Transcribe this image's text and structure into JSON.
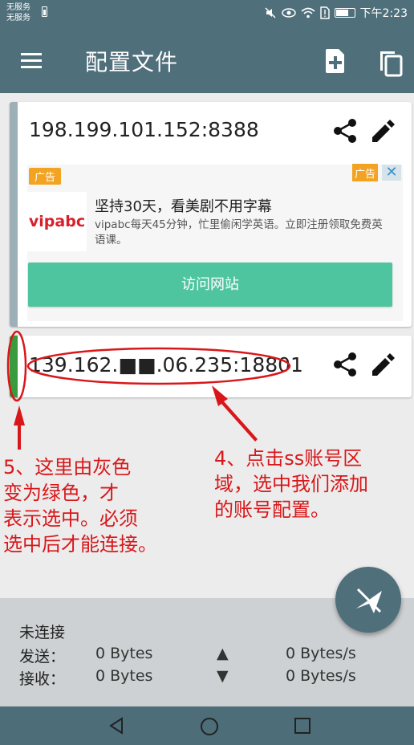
{
  "status_bar": {
    "carrier_line1": "无服务",
    "carrier_line2": "无服务",
    "time": "下午2:23"
  },
  "app_bar": {
    "title": "配置文件"
  },
  "profiles": [
    {
      "server": "198.199.101.152:8388",
      "selected": false,
      "indicator_color": "#9eb0b7"
    },
    {
      "server": "139.162.■■.06.235:18801",
      "selected": true,
      "indicator_color": "#3a9a3e"
    }
  ],
  "ad": {
    "tag_left": "广告",
    "tag_right": "广告",
    "close_label": "✕",
    "logo_text": "vipabc",
    "headline": "坚持30天，看美剧不用字幕",
    "description": "vipabc每天45分钟，忙里偷闲学英语。立即注册领取免费英语课。",
    "button_label": "访问网站"
  },
  "annotations": {
    "step5": [
      "5、这里由灰色",
      "变为绿色，才",
      "表示选中。必须",
      "选中后才能连接。"
    ],
    "step4": [
      "4、点击ss账号区",
      "域，选中我们添加",
      "的账号配置。"
    ],
    "color": "#d9171a"
  },
  "connection": {
    "status": "未连接",
    "sent_label": "发送：",
    "sent_value": "0 Bytes",
    "sent_rate": "0 Bytes/s",
    "recv_label": "接收：",
    "recv_value": "0 Bytes",
    "recv_rate": "0 Bytes/s",
    "up_arrow": "▲",
    "down_arrow": "▼"
  },
  "colors": {
    "primary": "#4f6f7b",
    "accent_button": "#4ec59e",
    "ad_tag": "#f3a322"
  },
  "icons": [
    "menu-icon",
    "add-file-icon",
    "copy-icon",
    "share-icon",
    "edit-icon",
    "paper-plane-off-icon",
    "nav-back-icon",
    "nav-home-icon",
    "nav-recent-icon"
  ]
}
